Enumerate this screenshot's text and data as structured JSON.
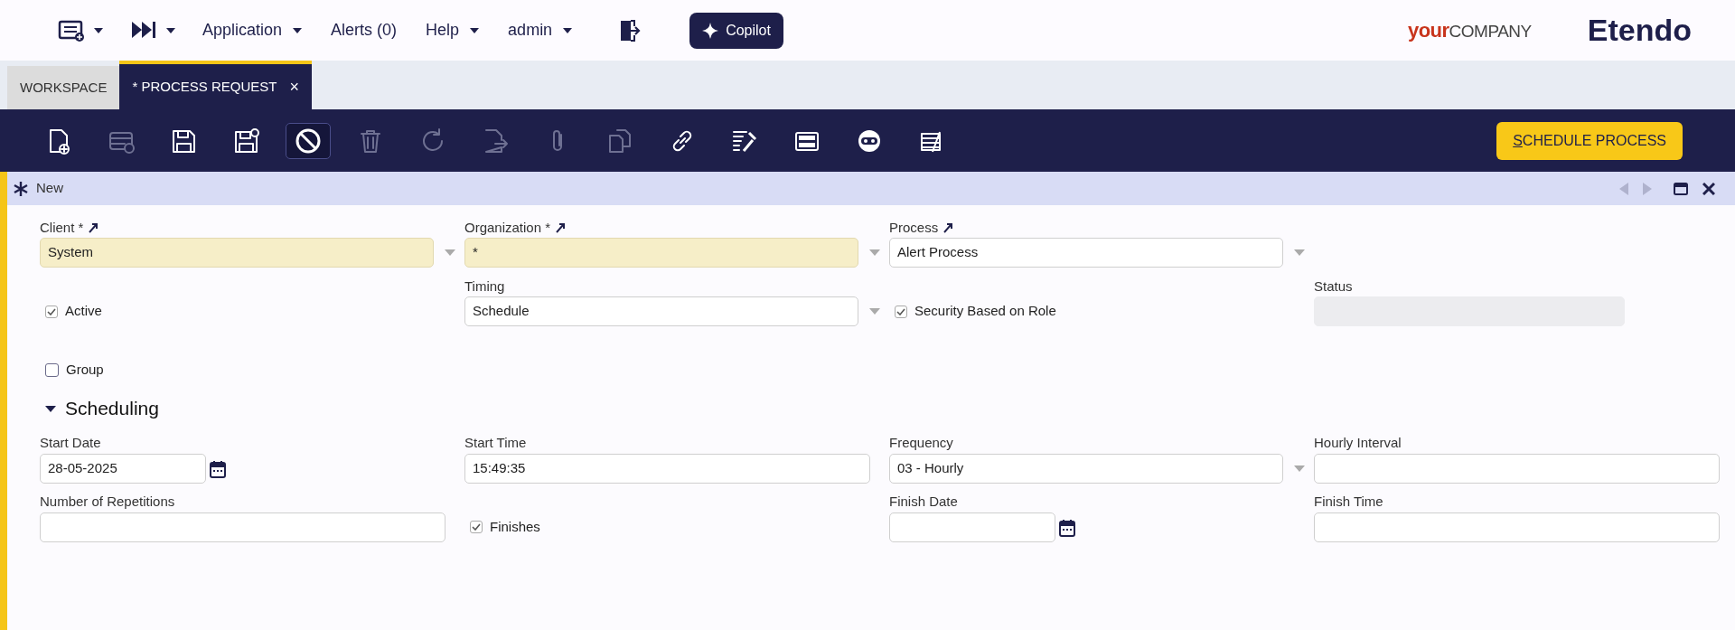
{
  "top_bar": {
    "icon_menus": [
      {
        "kind": "window-list",
        "dropdown": true
      },
      {
        "kind": "fast-forward",
        "dropdown": true
      }
    ],
    "menus": [
      {
        "label": "Application",
        "dropdown": true
      },
      {
        "label": "Alerts (0)",
        "dropdown": false
      },
      {
        "label": "Help",
        "dropdown": true
      },
      {
        "label": "admin",
        "dropdown": true
      }
    ],
    "copilot": "Copilot",
    "company_logo": {
      "part_1": "your",
      "part_2": "COMPANY"
    },
    "brand": "Etendo"
  },
  "tabs": [
    {
      "label": "WORKSPACE",
      "selected": false,
      "closable": false
    },
    {
      "label": "* PROCESS REQUEST",
      "selected": true,
      "closable": true,
      "close": "×"
    }
  ],
  "toolbar": {
    "buttons": [
      {
        "kind": "new",
        "disabled": false,
        "selected": false
      },
      {
        "kind": "new-row",
        "disabled": true,
        "selected": false
      },
      {
        "kind": "save",
        "disabled": false,
        "selected": false
      },
      {
        "kind": "save-close",
        "disabled": false,
        "selected": false
      },
      {
        "kind": "undo",
        "disabled": false,
        "selected": true
      },
      {
        "kind": "delete",
        "disabled": true,
        "selected": false
      },
      {
        "kind": "refresh",
        "disabled": true,
        "selected": false
      },
      {
        "kind": "export",
        "disabled": true,
        "selected": false
      },
      {
        "kind": "attach",
        "disabled": true,
        "selected": false
      },
      {
        "kind": "copy",
        "disabled": true,
        "selected": false
      },
      {
        "kind": "link",
        "disabled": false,
        "selected": false
      },
      {
        "kind": "tools",
        "disabled": false,
        "selected": false
      },
      {
        "kind": "grid",
        "disabled": false,
        "selected": false
      },
      {
        "kind": "bot",
        "disabled": false,
        "selected": false
      },
      {
        "kind": "notes",
        "disabled": false,
        "selected": false
      }
    ],
    "action": {
      "label": "SCHEDULE PROCESS"
    }
  },
  "record_header": {
    "title": "New",
    "prev_disabled": true,
    "next_disabled": true
  },
  "form": {
    "rows": [
      [
        {
          "kind": "select",
          "label": "Client *",
          "linked": true,
          "required": true,
          "value": "System"
        },
        {
          "kind": "select",
          "label": "Organization *",
          "linked": true,
          "required": true,
          "value": "*"
        },
        {
          "kind": "select",
          "label": "Process",
          "linked": true,
          "required": false,
          "value": "Alert Process"
        }
      ],
      [
        {
          "kind": "checkbox",
          "label": "Active",
          "checked": true
        },
        {
          "kind": "select",
          "label": "Timing",
          "linked": false,
          "required": false,
          "value": "Schedule"
        },
        {
          "kind": "checkbox",
          "label": "Security Based on Role",
          "checked": true
        },
        {
          "kind": "readonly",
          "label": "Status"
        }
      ],
      [
        {
          "kind": "checkbox",
          "label": "Group",
          "checked": false
        }
      ]
    ],
    "section": {
      "title": "Scheduling",
      "expanded": true,
      "rows": [
        [
          {
            "kind": "date",
            "label": "Start Date",
            "value": "28-05-2025"
          },
          {
            "kind": "text",
            "label": "Start Time",
            "value": "15:49:35"
          },
          {
            "kind": "select",
            "label": "Frequency",
            "linked": false,
            "required": false,
            "value": "03 - Hourly"
          },
          {
            "kind": "text",
            "label": "Hourly Interval"
          }
        ],
        [
          {
            "kind": "text",
            "label": "Number of Repetitions"
          },
          {
            "kind": "checkbox",
            "label": "Finishes",
            "checked": true
          },
          {
            "kind": "date",
            "label": "Finish Date"
          },
          {
            "kind": "text",
            "label": "Finish Time"
          }
        ]
      ]
    }
  }
}
